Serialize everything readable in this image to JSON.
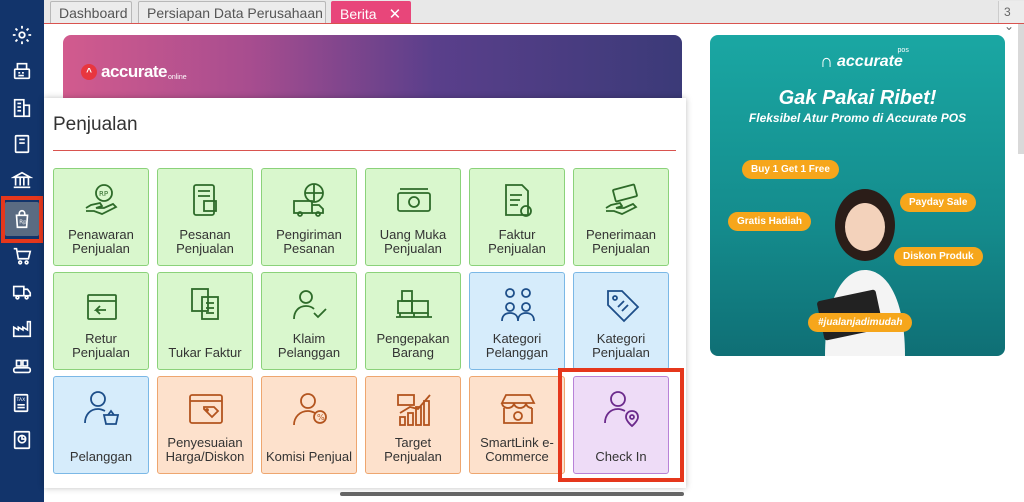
{
  "tabs": [
    {
      "label": "Dashboard"
    },
    {
      "label": "Persiapan Data Perusahaan"
    },
    {
      "label": "Berita",
      "close": "✕"
    }
  ],
  "tab_count": "3 ⌄",
  "banner": {
    "logo_text": "accurate",
    "logo_sub": "online"
  },
  "ad": {
    "logo_text": "accurate",
    "logo_pos": "pos",
    "title": "Gak Pakai Ribet!",
    "subtitle": "Fleksibel Atur Promo di Accurate POS",
    "pills": [
      "Buy 1 Get 1 Free",
      "Gratis Hadiah",
      "Payday Sale",
      "Diskon Produk"
    ],
    "hashtag": "#jualanjadimudah"
  },
  "panel": {
    "title": "Penjualan",
    "tiles": [
      {
        "label": "Penawaran\nPenjualan",
        "icon": "hand-money-icon",
        "color": "green"
      },
      {
        "label": "Pesanan\nPenjualan",
        "icon": "order-document-icon",
        "color": "green"
      },
      {
        "label": "Pengiriman\nPesanan",
        "icon": "delivery-truck-icon",
        "color": "green"
      },
      {
        "label": "Uang Muka\nPenjualan",
        "icon": "cash-icon",
        "color": "green"
      },
      {
        "label": "Faktur\nPenjualan",
        "icon": "invoice-icon",
        "color": "green"
      },
      {
        "label": "Penerimaan\nPenjualan",
        "icon": "receive-payment-icon",
        "color": "green"
      },
      {
        "label": "Retur\nPenjualan",
        "icon": "return-box-icon",
        "color": "green"
      },
      {
        "label": "Tukar Faktur",
        "icon": "exchange-invoice-icon",
        "color": "green"
      },
      {
        "label": "Klaim\nPelanggan",
        "icon": "customer-claim-icon",
        "color": "green"
      },
      {
        "label": "Pengepakan\nBarang",
        "icon": "packing-pallet-icon",
        "color": "green"
      },
      {
        "label": "Kategori\nPelanggan",
        "icon": "customer-category-icon",
        "color": "blue"
      },
      {
        "label": "Kategori\nPenjualan",
        "icon": "sales-tag-icon",
        "color": "blue"
      },
      {
        "label": "Pelanggan",
        "icon": "customer-basket-icon",
        "color": "blue"
      },
      {
        "label": "Penyesuaian\nHarga/Diskon",
        "icon": "price-adjust-icon",
        "color": "orange"
      },
      {
        "label": "Komisi Penjual",
        "icon": "sales-commission-icon",
        "color": "orange"
      },
      {
        "label": "Target\nPenjualan",
        "icon": "target-chart-icon",
        "color": "orange"
      },
      {
        "label": "SmartLink e-\nCommerce",
        "icon": "store-icon",
        "color": "orange"
      },
      {
        "label": "Check In",
        "icon": "check-in-user-icon",
        "color": "purple"
      }
    ]
  },
  "sidebar_icons": [
    "settings-icon",
    "fax-icon",
    "building-icon",
    "book-icon",
    "bank-icon",
    "sales-bag-icon",
    "cart-icon",
    "delivery-icon",
    "factory-icon",
    "conveyor-icon",
    "tax-icon",
    "report-icon"
  ]
}
